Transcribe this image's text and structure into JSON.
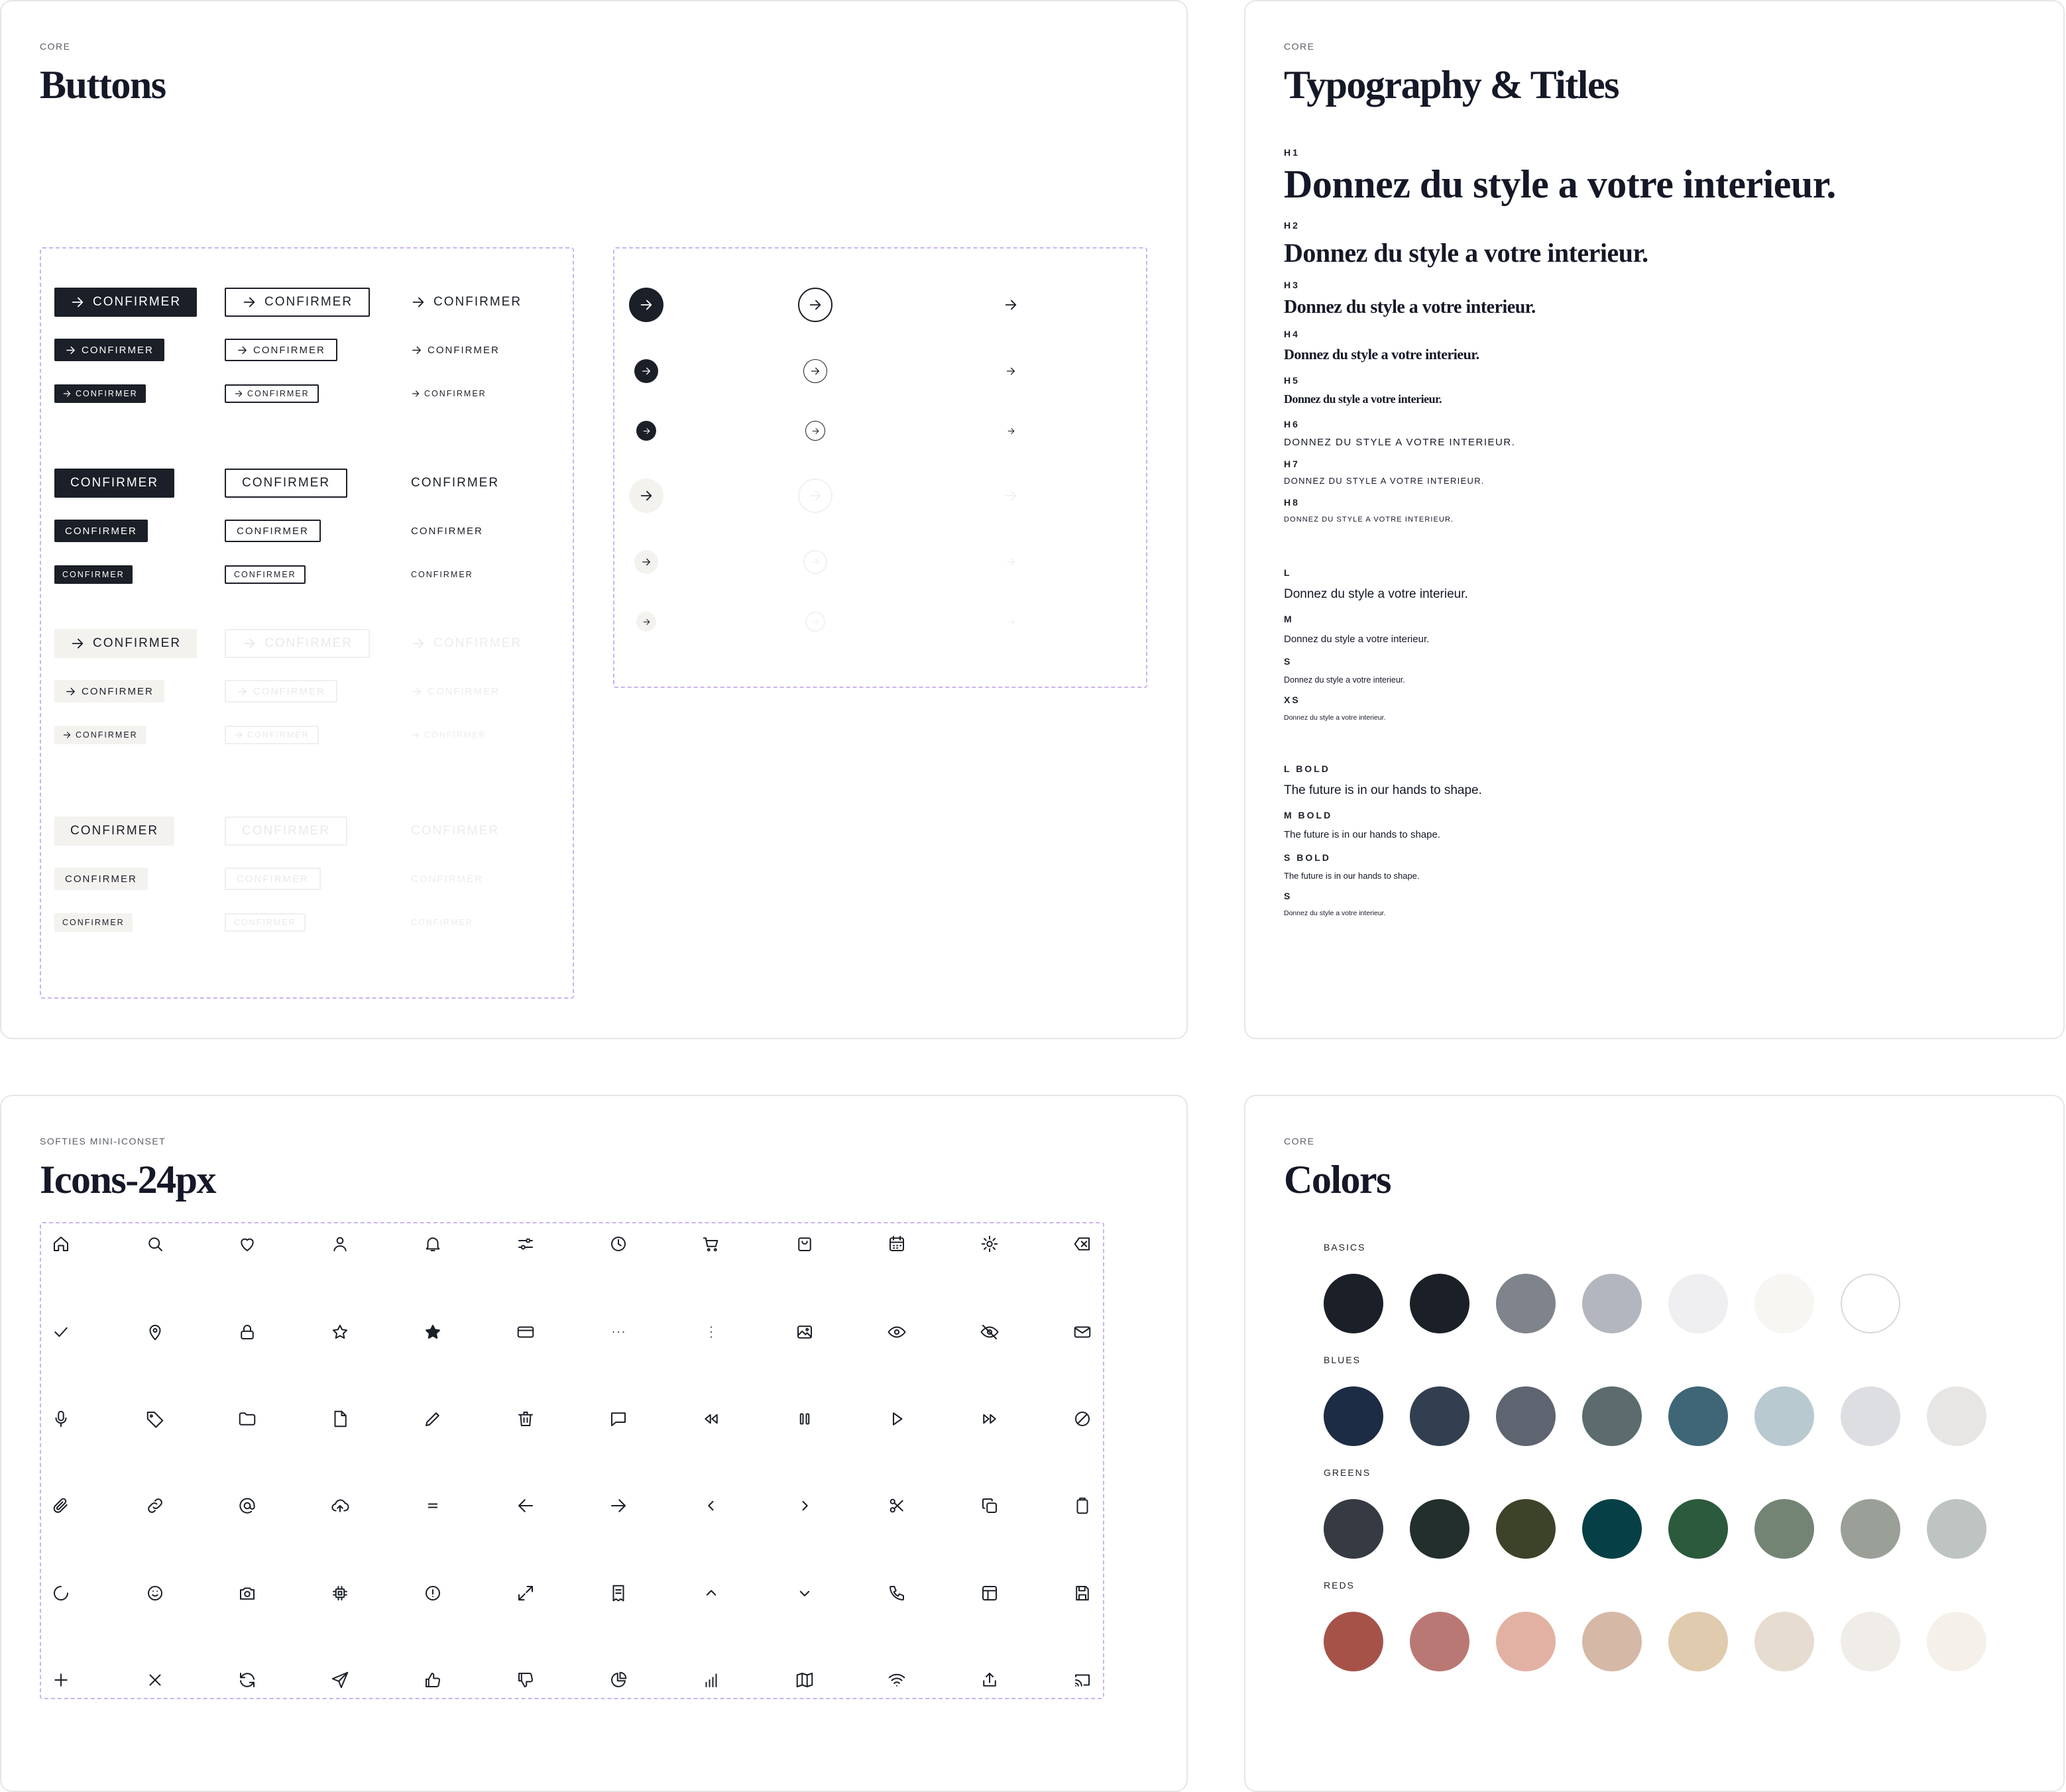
{
  "buttons_card": {
    "eyebrow": "CORE",
    "title": "Buttons",
    "label": "CONFIRMER"
  },
  "typography_card": {
    "eyebrow": "CORE",
    "title": "Typography & Titles",
    "sample": "Donnez du style a votre interieur.",
    "sample_upper": "DONNEZ DU STYLE A VOTRE INTERIEUR.",
    "bold_sample": "The future is in our hands to shape.",
    "labels": {
      "h1": "H1",
      "h2": "H2",
      "h3": "H3",
      "h4": "H4",
      "h5": "H5",
      "h6": "H6",
      "h7": "H7",
      "h8": "H8",
      "l": "L",
      "m": "M",
      "s": "S",
      "xs": "XS",
      "l_bold": "L BOLD",
      "m_bold": "M BOLD",
      "s_bold": "S BOLD",
      "s2": "S"
    }
  },
  "icons_card": {
    "eyebrow": "SOFTIES MINI-ICONSET",
    "title": "Icons-24px",
    "icons": [
      "home-icon",
      "search-icon",
      "heart-icon",
      "user-icon",
      "bell-icon",
      "sliders-icon",
      "clock-icon",
      "cart-icon",
      "bag-icon",
      "calendar-icon",
      "gear-icon",
      "backspace-icon",
      "check-icon",
      "location-pin-icon",
      "lock-icon",
      "star-outline-icon",
      "star-filled-icon",
      "card-icon",
      "more-horizontal-icon",
      "more-vertical-icon",
      "image-icon",
      "eye-icon",
      "eye-off-icon",
      "mail-icon",
      "microphone-icon",
      "tag-icon",
      "folder-icon",
      "file-icon",
      "pencil-icon",
      "trash-icon",
      "chat-icon",
      "rewind-icon",
      "pause-icon",
      "play-icon",
      "fast-forward-icon",
      "block-icon",
      "paperclip-icon",
      "link-icon",
      "at-icon",
      "cloud-upload-icon",
      "menu-lines-icon",
      "arrow-left-icon",
      "arrow-right-icon",
      "chevron-left-icon",
      "chevron-right-icon",
      "scissors-icon",
      "copy-icon",
      "clipboard-icon",
      "loader-icon",
      "smile-icon",
      "camera-icon",
      "chip-icon",
      "alert-circle-icon",
      "expand-icon",
      "receipt-icon",
      "chevron-up-icon",
      "chevron-down-icon",
      "phone-icon",
      "layout-icon",
      "save-icon",
      "plus-icon",
      "close-icon",
      "refresh-icon",
      "send-icon",
      "thumbs-up-icon",
      "thumbs-down-icon",
      "pie-chart-icon",
      "bar-chart-icon",
      "map-icon",
      "wifi-icon",
      "share-icon",
      "cast-icon"
    ]
  },
  "colors_card": {
    "eyebrow": "CORE",
    "title": "Colors",
    "groups": [
      {
        "name": "BASICS",
        "swatches": [
          "#1b1f27",
          "#1b1f27",
          "#7f838b",
          "#b4b6bf",
          "#efeff1",
          "#f7f6f3",
          "#ffffff"
        ]
      },
      {
        "name": "BLUES",
        "swatches": [
          "#1c2c44",
          "#323f50",
          "#5e6470",
          "#5b6b6e",
          "#3e6676",
          "#b8c9d0",
          "#dddee2",
          "#e8e6e4"
        ]
      },
      {
        "name": "GREENS",
        "swatches": [
          "#363a43",
          "#232f2d",
          "#3d4329",
          "#064046",
          "#2b5a3d",
          "#738474",
          "#9a9f97",
          "#bdc4c1"
        ]
      },
      {
        "name": "REDS",
        "swatches": [
          "#a65249",
          "#b97873",
          "#e2b1a3",
          "#d5b8a6",
          "#e1cbae",
          "#e7dcd0",
          "#f0ece8",
          "#f5f1ea"
        ]
      }
    ]
  }
}
